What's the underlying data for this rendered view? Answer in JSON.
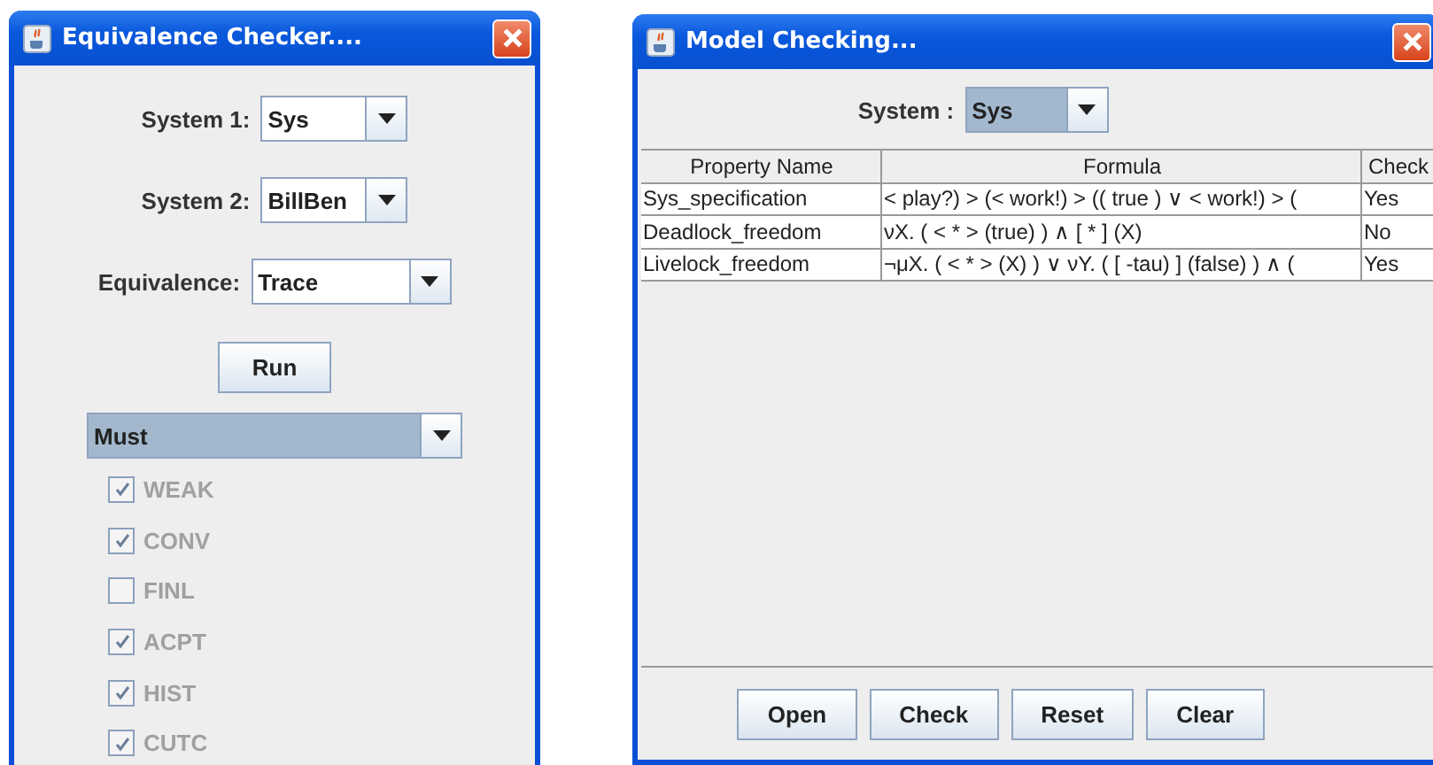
{
  "equivalence_window": {
    "title": "Equivalence Checker....",
    "fields": [
      {
        "label": "System 1:",
        "value": "Sys",
        "kind": "short"
      },
      {
        "label": "System 2:",
        "value": "BillBen",
        "kind": "short"
      },
      {
        "label": "Equivalence:",
        "value": "Trace",
        "kind": "wide"
      }
    ],
    "run_button": "Run",
    "mode_select": {
      "value": "Must",
      "selected": true
    },
    "options": [
      {
        "label": "WEAK",
        "checked": true,
        "disabled": true
      },
      {
        "label": "CONV",
        "checked": true,
        "disabled": true
      },
      {
        "label": "FINL",
        "checked": false,
        "disabled": true
      },
      {
        "label": "ACPT",
        "checked": true,
        "disabled": true
      },
      {
        "label": "HIST",
        "checked": true,
        "disabled": true
      },
      {
        "label": "CUTC",
        "checked": true,
        "disabled": true
      }
    ]
  },
  "model_window": {
    "title": "Model Checking...",
    "system": {
      "label": "System :",
      "value": "Sys",
      "selected": true
    },
    "table": {
      "columns": [
        "Property Name",
        "Formula",
        "Check"
      ],
      "rows": [
        [
          "Sys_specification",
          "< play?) > (< work!) > (( true )  ∨  < work!) > (",
          "Yes"
        ],
        [
          "Deadlock_freedom",
          "νX. ( < * > (true) ) ∧ [ * ] (X)",
          "No"
        ],
        [
          "Livelock_freedom",
          "¬μX. ( < * > (X) ) ∨ νY. ( [ -tau) ] (false) ) ∧ (",
          "Yes"
        ]
      ]
    },
    "buttons": [
      "Open",
      "Check",
      "Reset",
      "Clear"
    ]
  }
}
